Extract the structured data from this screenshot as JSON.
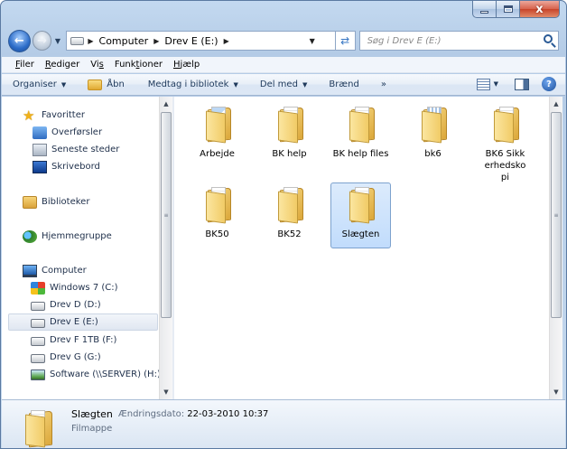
{
  "window": {
    "controls": {
      "close": "x"
    }
  },
  "nav": {
    "back_icon": "back-arrow-icon",
    "forward_icon": "forward-arrow-icon",
    "back_glyph": "←",
    "forward_glyph": "→"
  },
  "address": {
    "crumbs": [
      "Computer",
      "Drev E (E:)"
    ],
    "refresh_glyph": "⇄"
  },
  "search": {
    "placeholder": "Søg i Drev E (E:)"
  },
  "menu": [
    {
      "pre": "",
      "mn": "F",
      "post": "iler"
    },
    {
      "pre": "",
      "mn": "R",
      "post": "ediger"
    },
    {
      "pre": "Vi",
      "mn": "s",
      "post": ""
    },
    {
      "pre": "Funk",
      "mn": "t",
      "post": "ioner"
    },
    {
      "pre": "",
      "mn": "H",
      "post": "jælp"
    }
  ],
  "toolbar": {
    "organize": "Organiser",
    "open": "Åbn",
    "include_library": "Medtag i bibliotek",
    "share": "Del med",
    "burn": "Brænd",
    "more": "»",
    "help": "?"
  },
  "navpane": {
    "favorites": "Favoritter",
    "downloads": "Overførsler",
    "recent": "Seneste steder",
    "desktop": "Skrivebord",
    "libraries": "Biblioteker",
    "homegroup": "Hjemmegruppe",
    "computer": "Computer",
    "drives": [
      {
        "label": "Windows 7 (C:)",
        "icon": "windows-drive-icon"
      },
      {
        "label": "Drev D (D:)",
        "icon": "drive-icon"
      },
      {
        "label": "Drev E (E:)",
        "icon": "drive-icon",
        "selected": true
      },
      {
        "label": "Drev F 1TB (F:)",
        "icon": "drive-icon"
      },
      {
        "label": "Drev G (G:)",
        "icon": "drive-icon"
      },
      {
        "label": "Software (\\\\SERVER) (H:)",
        "icon": "network-drive-icon"
      }
    ]
  },
  "files": [
    {
      "name": "Arbejde",
      "icon": "folder-icon"
    },
    {
      "name": "BK help",
      "icon": "folder-icon"
    },
    {
      "name": "BK help files",
      "icon": "folder-icon"
    },
    {
      "name": "bk6",
      "icon": "folder-icon"
    },
    {
      "name": "BK6 Sikkerhedskopi",
      "icon": "folder-icon"
    },
    {
      "name": "BK50",
      "icon": "folder-icon"
    },
    {
      "name": "BK52",
      "icon": "folder-icon"
    },
    {
      "name": "Slægten",
      "icon": "folder-icon",
      "selected": true
    }
  ],
  "details": {
    "name": "Slægten",
    "modified_label": "Ændringsdato:",
    "modified_value": "22-03-2010 10:37",
    "type": "Filmappe"
  },
  "colors": {
    "selection": "#c1dcfc",
    "selection_border": "#7da2ce",
    "chrome": "#c3d9f0"
  }
}
